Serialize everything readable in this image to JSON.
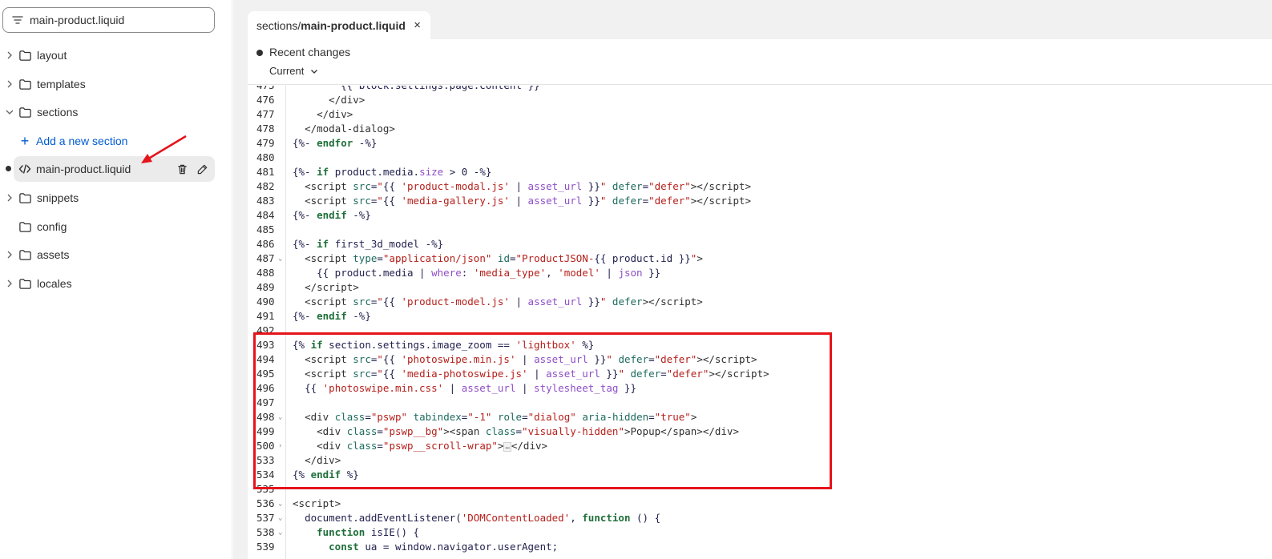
{
  "search": {
    "value": "main-product.liquid"
  },
  "tree": {
    "items": [
      {
        "label": "layout"
      },
      {
        "label": "templates"
      },
      {
        "label": "sections"
      },
      {
        "label": "Add a new section"
      },
      {
        "label": "main-product.liquid"
      },
      {
        "label": "snippets"
      },
      {
        "label": "config"
      },
      {
        "label": "assets"
      },
      {
        "label": "locales"
      }
    ]
  },
  "tab": {
    "path_prefix": "sections/",
    "file_name": "main-product.liquid",
    "close": "×"
  },
  "changes": {
    "title": "Recent changes",
    "version": "Current"
  },
  "code": {
    "line_numbers": [
      "475",
      "476",
      "477",
      "478",
      "479",
      "480",
      "481",
      "482",
      "483",
      "484",
      "485",
      "486",
      "487",
      "488",
      "489",
      "490",
      "491",
      "492",
      "493",
      "494",
      "495",
      "496",
      "497",
      "498",
      "499",
      "500",
      "533",
      "534",
      "535",
      "536",
      "537",
      "538",
      "539"
    ]
  },
  "colors": {
    "accent": "#005bd3",
    "highlight_border": "#e5141b",
    "keyword": "#1f6f3a",
    "string": "#b5201b",
    "filter": "#8e4ec6"
  }
}
